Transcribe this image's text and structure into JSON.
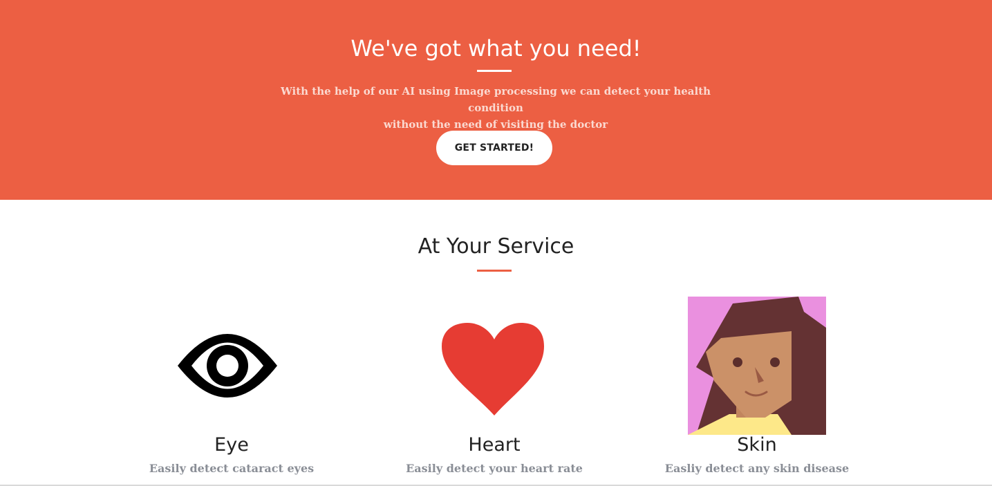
{
  "hero": {
    "title": "We've got what you need!",
    "subtitle_line1": "With the help of our AI using Image processing we can detect your health condition",
    "subtitle_line2": "without the need of visiting the doctor",
    "cta_label": "GET STARTED!",
    "background_color": "#ec5f43"
  },
  "services": {
    "title": "At Your Service",
    "accent_color": "#ec5f43",
    "items": [
      {
        "icon": "eye-icon",
        "title": "Eye",
        "description": "Easily detect cataract eyes"
      },
      {
        "icon": "heart-icon",
        "title": "Heart",
        "description": "Easily detect your heart rate"
      },
      {
        "icon": "avatar-face-icon",
        "title": "Skin",
        "description": "Easliy detect any skin disease"
      }
    ]
  }
}
